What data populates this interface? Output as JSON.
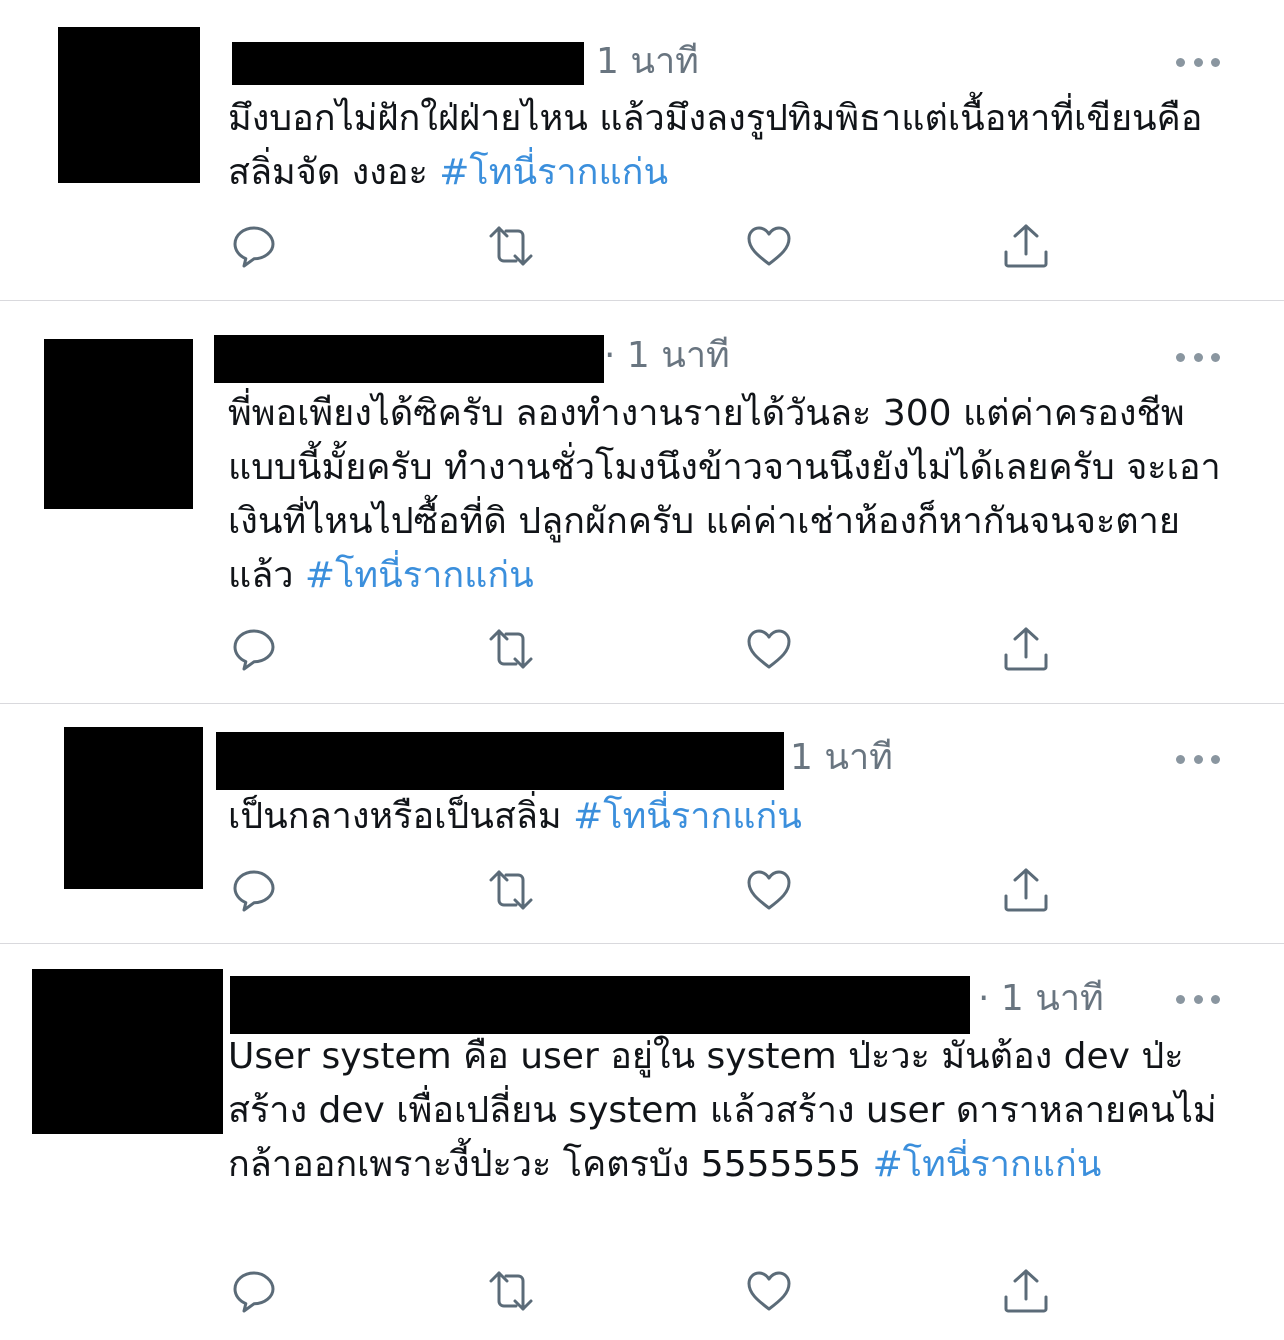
{
  "tweets": [
    {
      "time": "1 นาที",
      "text": "มึงบอกไม่ฝักใฝ่ฝ่ายไหน แล้วมึงลงรูปทิมพิธาแต่เนื้อหาที่เขียนคือสลิ่มจัด งงอะ ",
      "hashtag": "#โทนี่รากแก่น"
    },
    {
      "time": "· 1 นาที",
      "text": "พี่พอเพียงได้ซิครับ  ลองทำงานรายได้วันละ 300 แต่ค่าครองชีพแบบนี้มั้ยครับ ทำงานชั่วโมงนึงข้าวจานนึงยังไม่ได้เลยครับ จะเอาเงินที่ไหนไปซื้อที่ดิ ปลูกผักครับ แค่ค่าเช่าห้องก็หากันจนจะตายแล้ว ",
      "hashtag": "#โทนี่รากแก่น"
    },
    {
      "time": "1 นาที",
      "text": "เป็นกลางหรือเป็นสลิ่ม ",
      "hashtag": "#โทนี่รากแก่น"
    },
    {
      "time": "· 1 นาที",
      "text": "User system คือ user อยู่ใน system ป่ะวะ มันต้อง dev ป่ะ สร้าง dev เพื่อเปลี่ยน system แล้วสร้าง user ดาราหลายคนไม่กล้าออกเพราะงี้ป่ะวะ โคตรบัง 5555555 ",
      "hashtag": "#โทนี่รากแก่น"
    }
  ],
  "icons": {
    "reply": "reply-icon",
    "retweet": "retweet-icon",
    "like": "heart-icon",
    "share": "share-icon",
    "more": "more-icon"
  },
  "colors": {
    "hashtag": "#3b8fdc",
    "muted": "#697580",
    "icon": "#5b6b78",
    "divider": "#d9d9dd"
  }
}
